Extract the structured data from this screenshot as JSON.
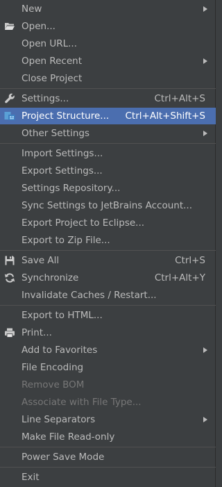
{
  "menu": {
    "items": {
      "new": {
        "label": "New"
      },
      "open": {
        "label": "Open..."
      },
      "open_url": {
        "label": "Open URL..."
      },
      "open_recent": {
        "label": "Open Recent"
      },
      "close_project": {
        "label": "Close Project"
      },
      "settings": {
        "label": "Settings...",
        "shortcut": "Ctrl+Alt+S"
      },
      "project_structure": {
        "label": "Project Structure...",
        "shortcut": "Ctrl+Alt+Shift+S"
      },
      "other_settings": {
        "label": "Other Settings"
      },
      "import_settings": {
        "label": "Import Settings..."
      },
      "export_settings": {
        "label": "Export Settings..."
      },
      "settings_repository": {
        "label": "Settings Repository..."
      },
      "sync_settings": {
        "label": "Sync Settings to JetBrains Account..."
      },
      "export_eclipse": {
        "label": "Export Project to Eclipse..."
      },
      "export_zip": {
        "label": "Export to Zip File..."
      },
      "save_all": {
        "label": "Save All",
        "shortcut": "Ctrl+S"
      },
      "synchronize": {
        "label": "Synchronize",
        "shortcut": "Ctrl+Alt+Y"
      },
      "invalidate_caches": {
        "label": "Invalidate Caches / Restart..."
      },
      "export_html": {
        "label": "Export to HTML..."
      },
      "print": {
        "label": "Print..."
      },
      "add_favorites": {
        "label": "Add to Favorites"
      },
      "file_encoding": {
        "label": "File Encoding"
      },
      "remove_bom": {
        "label": "Remove BOM"
      },
      "associate_file_type": {
        "label": "Associate with File Type..."
      },
      "line_separators": {
        "label": "Line Separators"
      },
      "make_read_only": {
        "label": "Make File Read-only"
      },
      "power_save": {
        "label": "Power Save Mode"
      },
      "exit": {
        "label": "Exit"
      }
    },
    "selected_item": "Project Structure...",
    "icons": {
      "open": "folder-open-icon",
      "settings": "wrench-icon",
      "project_structure": "project-structure-icon",
      "save_all": "floppy-disk-icon",
      "synchronize": "sync-icon",
      "print": "printer-icon"
    },
    "colors": {
      "background": "#3c3f41",
      "selection": "#4b6eaf",
      "text": "#bbbbbb",
      "disabled_text": "#777777",
      "separator": "#515151"
    }
  }
}
